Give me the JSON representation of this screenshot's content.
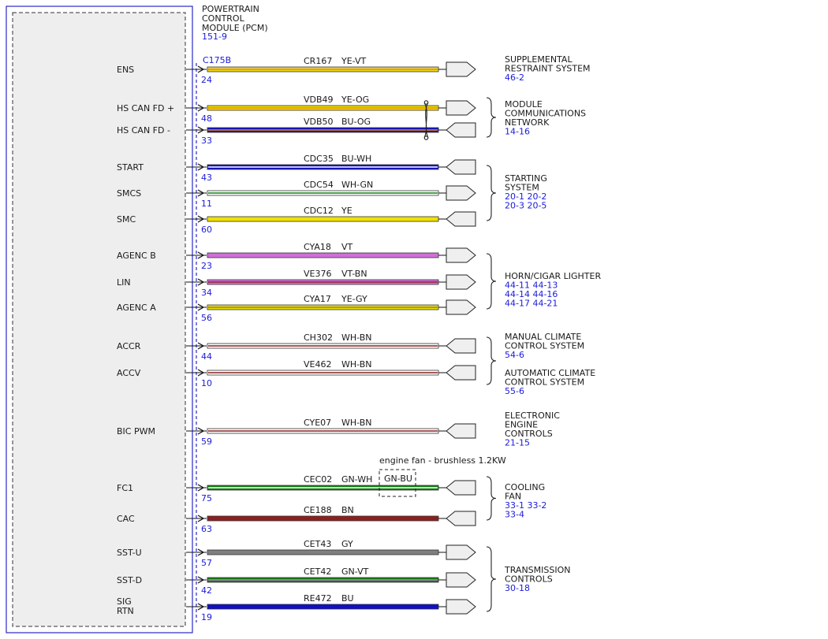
{
  "module": {
    "title_lines": [
      "POWERTRAIN",
      "CONTROL",
      "MODULE (PCM)"
    ],
    "page_ref": "151-9",
    "connector": "C175B"
  },
  "colors": {
    "YE": "#f0e000",
    "VT": "#d070d8",
    "BU": "#1010c8",
    "OG": "#f08c00",
    "WH": "#ffffff",
    "GN": "#108010",
    "GY": "#808080",
    "BN": "#8c2020",
    "border_blue": "#2828c8",
    "ref_blue": "#1a1adc"
  },
  "circuits": [
    {
      "signal": "ENS",
      "pin": "24",
      "circuit": "CR167",
      "color_code": "YE-VT",
      "base": "YE",
      "stripe": "VT",
      "connector": "out"
    },
    {
      "signal": "HS CAN FD +",
      "pin": "48",
      "circuit": "VDB49",
      "color_code": "YE-OG",
      "base": "YE",
      "stripe": "OG",
      "connector": "out"
    },
    {
      "signal": "HS CAN FD -",
      "pin": "33",
      "circuit": "VDB50",
      "color_code": "BU-OG",
      "base": "BU",
      "stripe": "OG",
      "connector": "in"
    },
    {
      "signal": "START",
      "pin": "43",
      "circuit": "CDC35",
      "color_code": "BU-WH",
      "base": "BU",
      "stripe": "WH",
      "connector": "in"
    },
    {
      "signal": "SMCS",
      "pin": "11",
      "circuit": "CDC54",
      "color_code": "WH-GN",
      "base": "WH",
      "stripe": "GN",
      "connector": "out"
    },
    {
      "signal": "SMC",
      "pin": "60",
      "circuit": "CDC12",
      "color_code": "YE",
      "base": "YE",
      "stripe": null,
      "connector": "in"
    },
    {
      "signal": "AGENC B",
      "pin": "23",
      "circuit": "CYA18",
      "color_code": "VT",
      "base": "VT",
      "stripe": null,
      "connector": "out"
    },
    {
      "signal": "LIN",
      "pin": "34",
      "circuit": "VE376",
      "color_code": "VT-BN",
      "base": "VT",
      "stripe": "BN",
      "connector": "out"
    },
    {
      "signal": "AGENC A",
      "pin": "56",
      "circuit": "CYA17",
      "color_code": "YE-GY",
      "base": "YE",
      "stripe": "GY",
      "connector": "out"
    },
    {
      "signal": "ACCR",
      "pin": "44",
      "circuit": "CH302",
      "color_code": "WH-BN",
      "base": "WH",
      "stripe": "BN",
      "connector": "in"
    },
    {
      "signal": "ACCV",
      "pin": "10",
      "circuit": "VE462",
      "color_code": "WH-BN",
      "base": "WH",
      "stripe": "BN",
      "connector": "in"
    },
    {
      "signal": "BIC PWM",
      "pin": "59",
      "circuit": "CYE07",
      "color_code": "WH-BN",
      "base": "WH",
      "stripe": "BN",
      "connector": "in"
    },
    {
      "signal": "FC1",
      "pin": "75",
      "circuit": "CEC02",
      "color_code": "GN-WH",
      "base": "GN",
      "stripe": "WH",
      "connector": "in"
    },
    {
      "signal": "CAC",
      "pin": "63",
      "circuit": "CE188",
      "color_code": "BN",
      "base": "BN",
      "stripe": null,
      "connector": "in"
    },
    {
      "signal": "SST-U",
      "pin": "57",
      "circuit": "CET43",
      "color_code": "GY",
      "base": "GY",
      "stripe": null,
      "connector": "out"
    },
    {
      "signal": "SST-D",
      "pin": "42",
      "circuit": "CET42",
      "color_code": "GN-VT",
      "base": "GN",
      "stripe": "VT",
      "connector": "out"
    },
    {
      "signal_lines": [
        "SIG",
        "RTN"
      ],
      "pin": "19",
      "circuit": "RE472",
      "color_code": "BU",
      "base": "BU",
      "stripe": null,
      "connector": "out"
    }
  ],
  "fan_note": {
    "label": "engine fan - brushless 1.2KW",
    "alt_color": "GN-BU"
  },
  "destinations": [
    {
      "lines": [
        "SUPPLEMENTAL",
        "RESTRAINT SYSTEM"
      ],
      "refs": [
        "46-2"
      ],
      "brace": false
    },
    {
      "lines": [
        "MODULE",
        "COMMUNICATIONS",
        "NETWORK"
      ],
      "refs": [
        "14-16"
      ],
      "brace": true
    },
    {
      "lines": [
        "STARTING",
        "SYSTEM"
      ],
      "refs": [
        "20-1   20-2",
        "20-3   20-5"
      ],
      "brace": true
    },
    {
      "lines": [
        "HORN/CIGAR LIGHTER"
      ],
      "refs": [
        "44-11   44-13",
        "44-14   44-16",
        "44-17   44-21"
      ],
      "brace": true
    },
    {
      "lines": [
        "MANUAL CLIMATE",
        "CONTROL SYSTEM"
      ],
      "refs": [
        "54-6"
      ],
      "brace": true
    },
    {
      "lines": [
        "AUTOMATIC CLIMATE",
        "CONTROL SYSTEM"
      ],
      "refs": [
        "55-6"
      ],
      "brace": false
    },
    {
      "lines": [
        "ELECTRONIC",
        "ENGINE",
        "CONTROLS"
      ],
      "refs": [
        "21-15"
      ],
      "brace": false
    },
    {
      "lines": [
        "COOLING",
        "FAN"
      ],
      "refs": [
        "33-1   33-2",
        "33-4"
      ],
      "brace": true
    },
    {
      "lines": [
        "TRANSMISSION",
        "CONTROLS"
      ],
      "refs": [
        "30-18"
      ],
      "brace": true
    }
  ]
}
